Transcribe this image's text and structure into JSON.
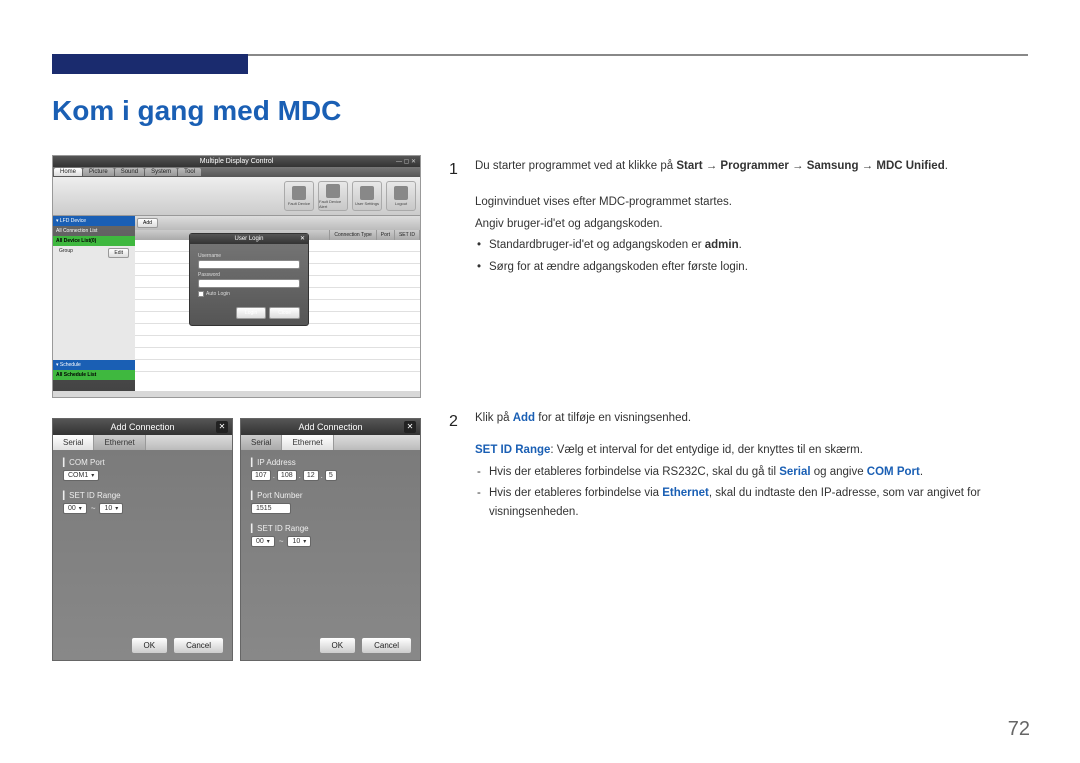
{
  "page": {
    "title": "Kom i gang med MDC",
    "number": "72"
  },
  "shot1": {
    "windowTitle": "Multiple Display Control",
    "tabs": [
      "Home",
      "Picture",
      "Sound",
      "System",
      "Tool"
    ],
    "toolbarIcons": [
      "Fault Device",
      "Fault Device Alert",
      "User Settings",
      "Logout"
    ],
    "sidebar": {
      "lfd": "▾ LFD Device",
      "connList": "All Connection List",
      "deviceList": "All Device List(0)",
      "group": "Group",
      "editBtn": "Edit",
      "schedule": "▾ Schedule",
      "schedList": "All Schedule List"
    },
    "contentBtns": {
      "add": "Add"
    },
    "tableHeaders": [
      "Connection Type",
      "Port",
      "SET ID"
    ]
  },
  "login": {
    "title": "User Login",
    "username": "Username",
    "password": "Password",
    "auto": "Auto Login",
    "login": "Login",
    "close": "Close"
  },
  "addconn": {
    "title": "Add Connection",
    "tabSerial": "Serial",
    "tabEthernet": "Ethernet",
    "comPort": "COM Port",
    "comVal": "COM1",
    "setIdRange": "SET ID Range",
    "idFrom": "00",
    "idTo": "10",
    "ipAddress": "IP Address",
    "ip": [
      "107",
      "108",
      "12",
      "5"
    ],
    "portNumber": "Port Number",
    "portVal": "1515",
    "ok": "OK",
    "cancel": "Cancel"
  },
  "text": {
    "step1": {
      "line1a": "Du starter programmet ved at klikke på ",
      "line1b": "Start → Programmer → Samsung → MDC Unified",
      "line1c": ".",
      "p2": "Loginvinduet vises efter MDC-programmet startes.",
      "p3": "Angiv bruger-id'et og adgangskoden.",
      "li1a": "Standardbruger-id'et og adgangskoden er ",
      "li1b": "admin",
      "li1c": ".",
      "li2": "Sørg for at ændre adgangskoden efter første login."
    },
    "step2": {
      "line1a": "Klik på ",
      "line1b": "Add",
      "line1c": " for at tilføje en visningsenhed.",
      "p2a": "SET ID Range",
      "p2b": ": Vælg et interval for det entydige id, der knyttes til en skærm.",
      "d1a": "Hvis der etableres forbindelse via RS232C, skal du gå til ",
      "d1b": "Serial",
      "d1c": " og angive ",
      "d1d": "COM Port",
      "d1e": ".",
      "d2a": "Hvis der etableres forbindelse via ",
      "d2b": "Ethernet",
      "d2c": ", skal du indtaste den IP-adresse, som var angivet for visningsenheden."
    }
  }
}
